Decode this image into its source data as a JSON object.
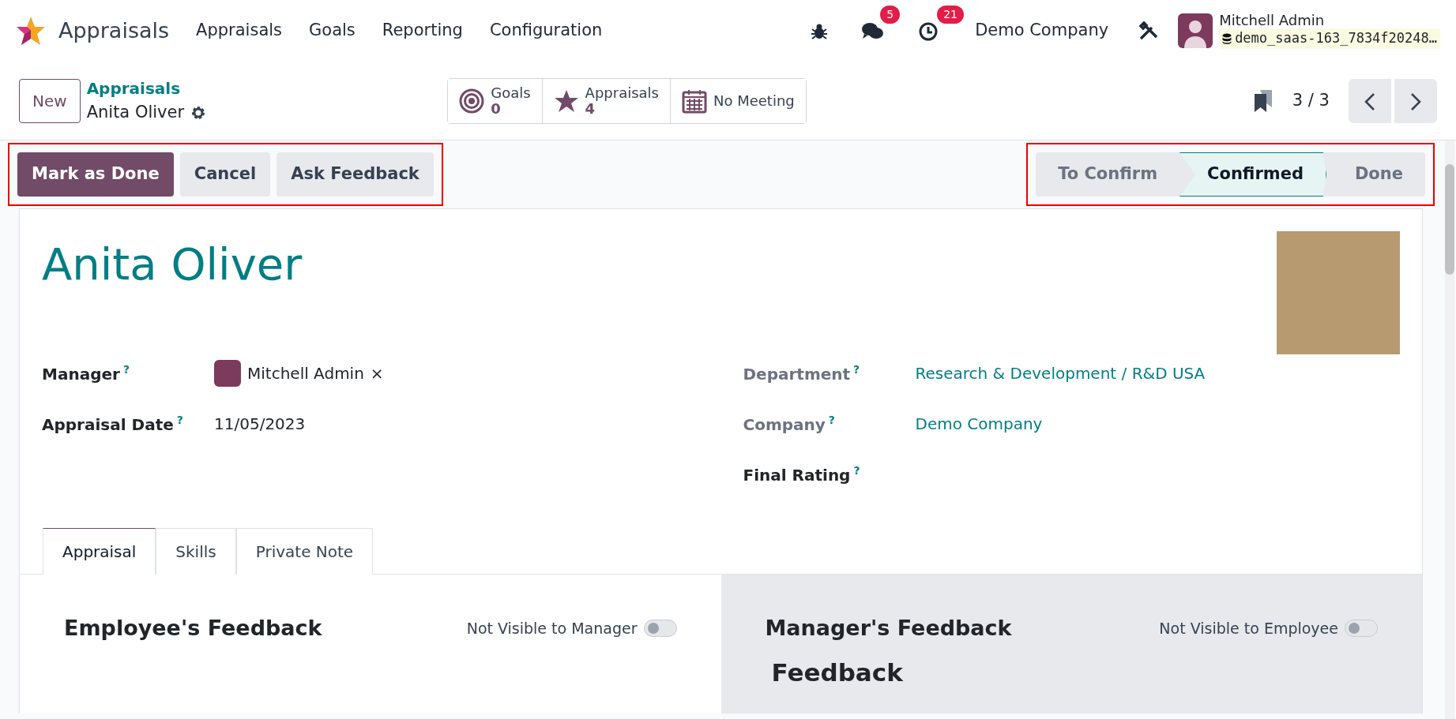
{
  "navbar": {
    "app_name": "Appraisals",
    "menu": [
      "Appraisals",
      "Goals",
      "Reporting",
      "Configuration"
    ],
    "messages_count": "5",
    "activities_count": "21",
    "company": "Demo Company",
    "user": {
      "name": "Mitchell Admin",
      "database": "demo_saas-163_7834f20248…"
    }
  },
  "control_panel": {
    "new_button": "New",
    "breadcrumb": "Appraisals",
    "record_name": "Anita Oliver",
    "smart_buttons": [
      {
        "kind": "target",
        "label": "Goals",
        "value": "0"
      },
      {
        "kind": "star",
        "label": "Appraisals",
        "value": "4"
      },
      {
        "kind": "calendar",
        "label": "No Meeting"
      }
    ],
    "pager": "3 / 3"
  },
  "status_bar": {
    "buttons": [
      {
        "label": "Mark as Done",
        "primary": true
      },
      {
        "label": "Cancel",
        "primary": false
      },
      {
        "label": "Ask Feedback",
        "primary": false
      }
    ],
    "stages": [
      {
        "label": "To Confirm",
        "selected": false
      },
      {
        "label": "Confirmed",
        "selected": true
      },
      {
        "label": "Done",
        "selected": false
      }
    ]
  },
  "form": {
    "title": "Anita Oliver",
    "left_fields": [
      {
        "kind": "user",
        "label": "Manager",
        "help": "?",
        "value": "Mitchell Admin",
        "remove": "×",
        "muted": false
      },
      {
        "kind": "text",
        "label": "Appraisal Date",
        "help": "?",
        "value": "11/05/2023",
        "muted": false
      }
    ],
    "right_fields": [
      {
        "kind": "link",
        "label": "Department",
        "help": "?",
        "value": "Research & Development / R&D USA",
        "muted": true
      },
      {
        "kind": "link",
        "label": "Company",
        "help": "?",
        "value": "Demo Company",
        "muted": true
      },
      {
        "kind": "text",
        "label": "Final Rating",
        "help": "?",
        "muted": false
      }
    ],
    "tabs": [
      {
        "label": "Appraisal",
        "selected": true
      },
      {
        "label": "Skills",
        "selected": false
      },
      {
        "label": "Private Note",
        "selected": false
      }
    ],
    "feedback_panels": [
      {
        "title": "Employee's Feedback",
        "toggle_label": "Not Visible to Manager",
        "on": false,
        "shaded": false
      },
      {
        "title": "Manager's Feedback",
        "toggle_label": "Not Visible to Employee",
        "on": false,
        "shaded": true,
        "subheading": "Feedback"
      }
    ]
  }
}
